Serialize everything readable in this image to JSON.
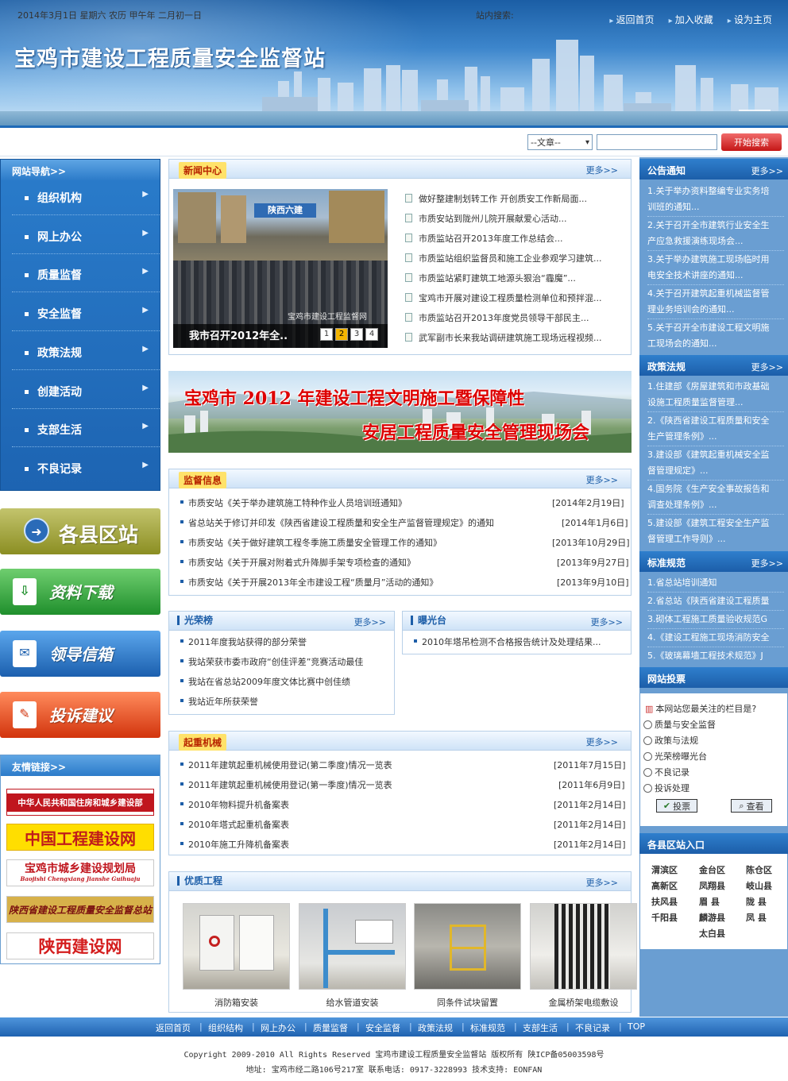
{
  "header": {
    "site_title": "宝鸡市建设工程质量安全监督站",
    "top_links": [
      "返回首页",
      "加入收藏",
      "设为主页"
    ]
  },
  "infobar": {
    "date_text": "2014年3月1日  星期六  农历  甲午年  二月初一日",
    "search_label": "站内搜索:",
    "search_select": "--文章--",
    "search_placeholder": "",
    "search_button": "开始搜索"
  },
  "nav": {
    "title": "网站导航>>",
    "items": [
      "组织机构",
      "网上办公",
      "质量监督",
      "安全监督",
      "政策法规",
      "创建活动",
      "支部生活",
      "不良记录"
    ]
  },
  "banners": {
    "county": "各县区站",
    "download": "资料下载",
    "mailbox": "领导信箱",
    "complaint": "投诉建议"
  },
  "friend_links": {
    "title": "友情链接>>",
    "items": [
      "中华人民共和国住房和城乡建设部",
      "中国工程建设网",
      "宝鸡市城乡建设规划局",
      "陕西省建设工程质量安全监督总站",
      "陕西建设网"
    ],
    "sub3": "Baojishi Chengxiang Jianshe Guihuaju"
  },
  "news": {
    "title": "新闻中心",
    "more": "更多>>",
    "caption": "我市召开2012年全..",
    "watermark": "宝鸡市建设工程监督网",
    "sign_text": "陕西六建",
    "pages": [
      "1",
      "2",
      "3",
      "4"
    ],
    "active_page": "2",
    "items": [
      "做好整建制划转工作  开创质安工作新局面...",
      "市质安站到陇州儿院开展献爱心活动...",
      "市质监站召开2013年度工作总结会...",
      "市质监站组织监督员和施工企业参观学习建筑...",
      "市质监站紧盯建筑工地源头狠治“霾魔”...",
      "宝鸡市开展对建设工程质量检测单位和预拌混...",
      "市质监站召开2013年度党员领导干部民主...",
      "武军副市长来我站调研建筑施工现场远程视频..."
    ]
  },
  "big_banner": {
    "line1": "宝鸡市 2012 年建设工程文明施工暨保障性",
    "line2": "安居工程质量安全管理现场会"
  },
  "supervision": {
    "title": "监督信息",
    "more": "更多>>",
    "rows": [
      {
        "t": "市质安站《关于举办建筑施工特种作业人员培训班通知》",
        "d": "[2014年2月19日]"
      },
      {
        "t": "省总站关于修订并印发《陕西省建设工程质量和安全生产监督管理规定》的通知",
        "d": "[2014年1月6日]"
      },
      {
        "t": "市质安站《关于做好建筑工程冬季施工质量安全管理工作的通知》",
        "d": "[2013年10月29日]"
      },
      {
        "t": "市质安站《关于开展对附着式升降脚手架专项检查的通知》",
        "d": "[2013年9月27日]"
      },
      {
        "t": "市质安站《关于开展2013年全市建设工程“质量月”活动的通知》",
        "d": "[2013年9月10日]"
      }
    ]
  },
  "honor": {
    "title": "光荣榜",
    "more": "更多>>",
    "items": [
      "2011年度我站获得的部分荣誉",
      "我站荣获市委市政府“创佳评差”竞赛活动最佳",
      "我站在省总站2009年度文体比赛中创佳绩",
      "我站近年所获荣誉"
    ]
  },
  "exposure": {
    "title": "曝光台",
    "more": "更多>>",
    "items": [
      "2010年塔吊检测不合格报告统计及处理结果..."
    ]
  },
  "cranes": {
    "title": "起重机械",
    "more": "更多>>",
    "rows": [
      {
        "t": "2011年建筑起重机械使用登记(第二季度)情况一览表",
        "d": "[2011年7月15日]"
      },
      {
        "t": "2011年建筑起重机械使用登记(第一季度)情况一览表",
        "d": "[2011年6月9日]"
      },
      {
        "t": "2010年物料提升机备案表",
        "d": "[2011年2月14日]"
      },
      {
        "t": "2010年塔式起重机备案表",
        "d": "[2011年2月14日]"
      },
      {
        "t": "2010年施工升降机备案表",
        "d": "[2011年2月14日]"
      }
    ]
  },
  "quality": {
    "title": "优质工程",
    "more": "更多>>",
    "items": [
      "消防箱安装",
      "给水管道安装",
      "同条件试块留置",
      "金属桥架电缆敷设"
    ]
  },
  "right": {
    "notice": {
      "title": "公告通知",
      "more": "更多>>",
      "lines": [
        "1.关于举办资料整编专业实务培",
        "训班的通知...",
        "2.关于召开全市建筑行业安全生",
        "产应急救援演练现场会...",
        "3.关于举办建筑施工现场临时用",
        "电安全技术讲座的通知...",
        "4.关于召开建筑起重机械监督管",
        "理业务培训会的通知...",
        "5.关于召开全市建设工程文明施",
        "工现场会的通知..."
      ]
    },
    "policy": {
      "title": "政策法规",
      "more": "更多>>",
      "lines": [
        "1.住建部《房屋建筑和市政基础",
        "设施工程质量监督管理...",
        "2.《陕西省建设工程质量和安全",
        "生产管理条例》...",
        "3.建设部《建筑起重机械安全监",
        "督管理规定》...",
        "4.国务院《生产安全事故报告和",
        "调查处理条例》...",
        "5.建设部《建筑工程安全生产监",
        "督管理工作导则》..."
      ]
    },
    "standards": {
      "title": "标准规范",
      "more": "更多>>",
      "lines": [
        "1.省总站培训通知",
        "2.省总站《陕西省建设工程质量",
        "3.砌体工程施工质量验收规范G",
        "4.《建设工程施工现场消防安全",
        "5.《玻璃幕墙工程技术规范》J"
      ]
    },
    "vote": {
      "title": "网站投票",
      "question": "本网站您最关注的栏目是?",
      "options": [
        "质量与安全监督",
        "政策与法规",
        "光荣榜曝光台",
        "不良记录",
        "投诉处理"
      ],
      "vote_button": "投票",
      "view_button": "查看"
    },
    "counties": {
      "title": "各县区站入口",
      "rows": [
        [
          "渭滨区",
          "金台区",
          "陈仓区"
        ],
        [
          "高新区",
          "凤翔县",
          "岐山县"
        ],
        [
          "扶风县",
          "眉 县",
          "陇 县"
        ],
        [
          "千阳县",
          "麟游县",
          "凤 县"
        ],
        [
          "",
          "太白县",
          ""
        ]
      ]
    }
  },
  "footer": {
    "nav": [
      "返回首页",
      "组织结构",
      "网上办公",
      "质量监督",
      "安全监督",
      "政策法规",
      "标准规范",
      "支部生活",
      "不良记录",
      "TOP"
    ],
    "copyright": "Copyright 2009-2010 All Rights Reserved 宝鸡市建设工程质量安全监督站 版权所有 陕ICP备05003598号",
    "address": "地址: 宝鸡市经二路106号217室  联系电话: 0917-3228993  技术支持: EONFAN"
  }
}
